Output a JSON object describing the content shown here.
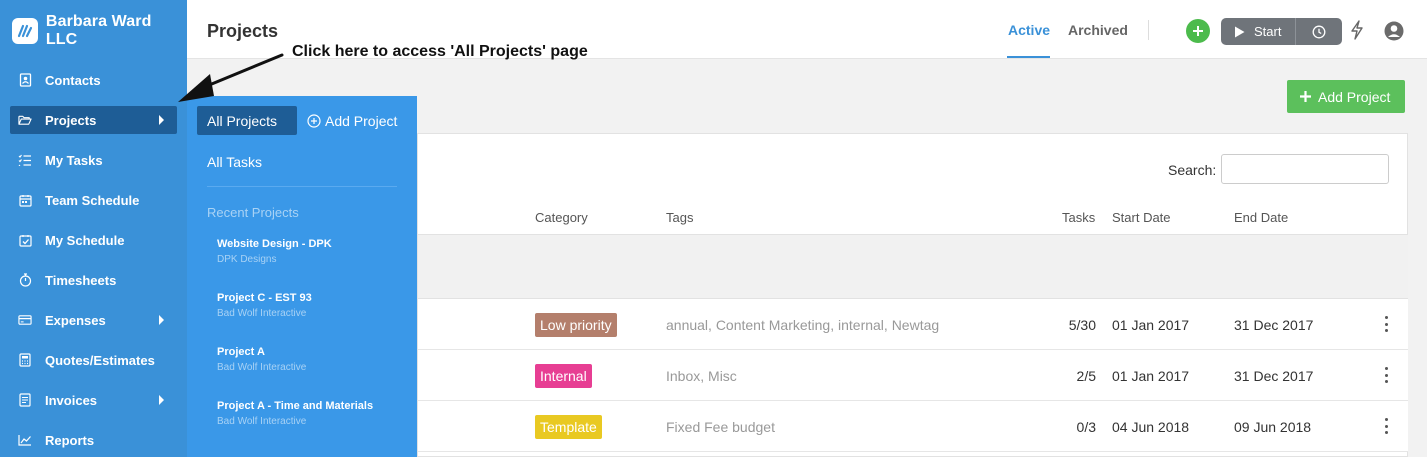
{
  "brand": {
    "name": "Barbara Ward LLC",
    "logo_icon": "brand-logo-icon"
  },
  "sidebar": {
    "items": [
      {
        "label": "Contacts",
        "icon": "contacts-icon"
      },
      {
        "label": "Projects",
        "icon": "folder-open-icon",
        "active": true,
        "submenu": true
      },
      {
        "label": "My Tasks",
        "icon": "task-list-icon"
      },
      {
        "label": "Team Schedule",
        "icon": "calendar-icon"
      },
      {
        "label": "My Schedule",
        "icon": "calendar-check-icon"
      },
      {
        "label": "Timesheets",
        "icon": "stopwatch-icon"
      },
      {
        "label": "Expenses",
        "icon": "card-icon",
        "submenu": true
      },
      {
        "label": "Quotes/Estimates",
        "icon": "calculator-icon"
      },
      {
        "label": "Invoices",
        "icon": "invoice-icon",
        "submenu": true
      },
      {
        "label": "Reports",
        "icon": "chart-icon"
      }
    ]
  },
  "flyout": {
    "all_projects": "All Projects",
    "add_project": "Add Project",
    "all_tasks": "All Tasks",
    "recent_heading": "Recent Projects",
    "recent": [
      {
        "title": "Website Design - DPK",
        "client": "DPK Designs"
      },
      {
        "title": "Project C - EST 93",
        "client": "Bad Wolf Interactive"
      },
      {
        "title": "Project A",
        "client": "Bad Wolf Interactive"
      },
      {
        "title": "Project A - Time and Materials",
        "client": "Bad Wolf Interactive"
      }
    ]
  },
  "header": {
    "title": "Projects",
    "tabs": {
      "active": "Active",
      "archived": "Archived"
    },
    "start_label": "Start"
  },
  "main": {
    "add_project_label": "Add Project",
    "search_label": "Search:",
    "search_value": "",
    "columns": {
      "category": "Category",
      "tags": "Tags",
      "tasks": "Tasks",
      "start": "Start Date",
      "end": "End Date"
    },
    "rows": [
      {
        "category": "Low priority",
        "category_color": "#b47f6c",
        "tags": "annual, Content Marketing, internal, Newtag",
        "tasks": "5/30",
        "start": "01 Jan 2017",
        "end": "31 Dec 2017"
      },
      {
        "category": "Internal",
        "category_color": "#e73e93",
        "tags": "Inbox, Misc",
        "tasks": "2/5",
        "start": "01 Jan 2017",
        "end": "31 Dec 2017"
      },
      {
        "category": "Template",
        "category_color": "#e9c922",
        "tags": "Fixed Fee budget",
        "tasks": "0/3",
        "start": "04 Jun 2018",
        "end": "09 Jun 2018"
      }
    ]
  },
  "annotation": {
    "text": "Click here to access 'All Projects' page"
  },
  "colors": {
    "sidebar": "#3a91d8",
    "flyout": "#3a98e8",
    "active_nav": "#1e5d96",
    "accent_green": "#5cc05c",
    "tab_active": "#3a91d8"
  }
}
